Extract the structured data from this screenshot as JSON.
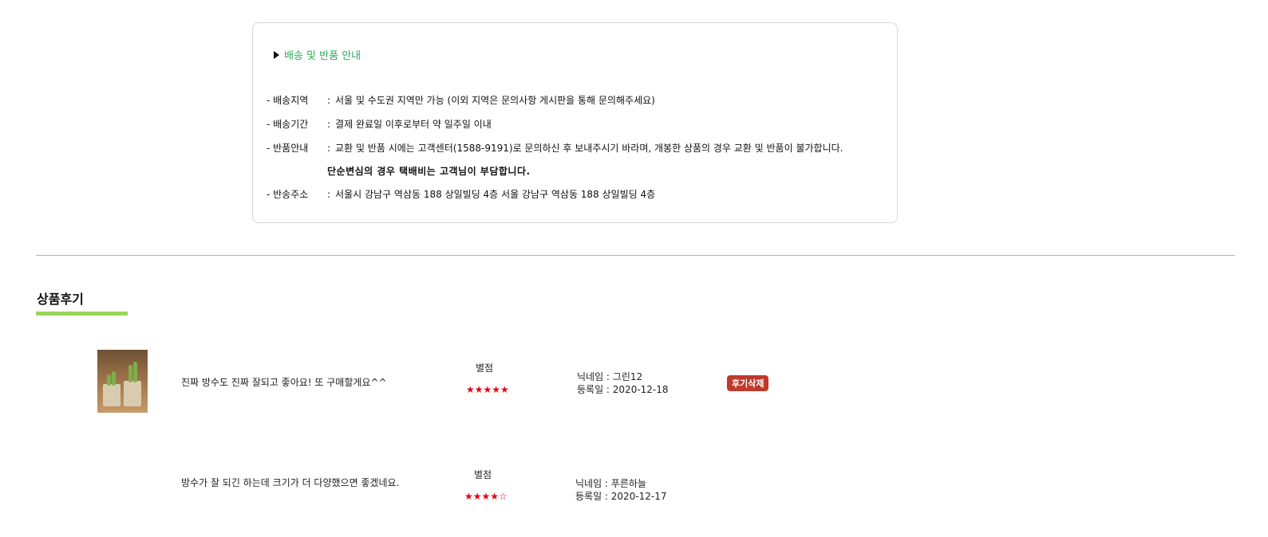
{
  "shipping": {
    "heading": "배송 및 반품 안내",
    "lines": [
      {
        "label": "- 배송지역",
        "value": "서울 및 수도권 지역만 가능 (이외 지역은 문의사항 게시판을 통해 문의해주세요)"
      },
      {
        "label": "- 배송기간",
        "value": "결제 완료일 이후로부터 약 일주일 이내"
      },
      {
        "label": "- 반품안내",
        "value": "교환 및 반품 시에는 고객센터(1588-9191)로 문의하신 후 보내주시기 바라며, 개봉한 상품의 경우 교환 및 반품이 불가합니다."
      },
      {
        "label": "- 반송주소",
        "value": "서울시 강남구 역삼동 188 상일빌딩 4층 서울 강남구 역삼동 188 상일빌딩 4층"
      }
    ],
    "separator": ":",
    "bold_note": "단순변심의 경우 택배비는 고객님이 부담합니다."
  },
  "reviews": {
    "title": "상품후기",
    "accent_color": "#9ad45a",
    "items": [
      {
        "text": "진짜 방수도 진짜 잘되고 좋아요! 또 구매할게요^^",
        "rating_label": "별점",
        "stars": "★★★★★",
        "rating": 5,
        "nickname": "닉네임 : 그린12",
        "date": "등록일 : 2020-12-18",
        "has_image": true,
        "delete_label": "후기삭제"
      },
      {
        "text": "방수가 잘 되긴 하는데 크기가 더 다양했으면 좋겠네요.",
        "rating_label": "별점",
        "stars": "★★★★☆",
        "rating": 4,
        "nickname": "닉네임 : 푸른하늘",
        "date": "등록일 : 2020-12-17",
        "has_image": false
      }
    ]
  }
}
